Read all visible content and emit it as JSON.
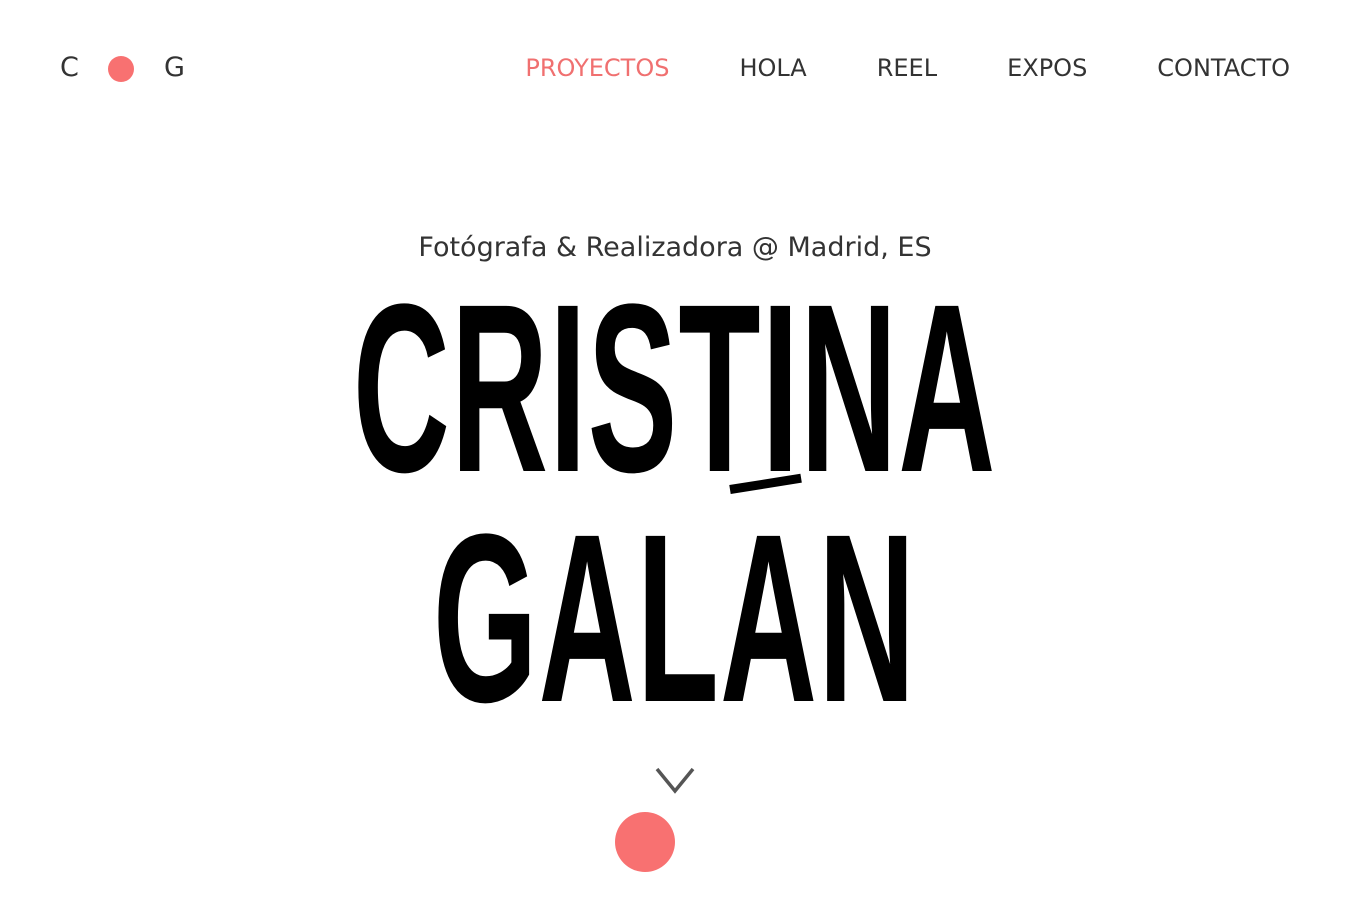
{
  "logo": {
    "left_letter": "C",
    "right_letter": "G",
    "dot_color": "#f87171"
  },
  "nav": {
    "active_color": "#f07070",
    "items": [
      {
        "label": "PROYECTOS",
        "active": true
      },
      {
        "label": "HOLA",
        "active": false
      },
      {
        "label": "REEL",
        "active": false
      },
      {
        "label": "EXPOS",
        "active": false
      },
      {
        "label": "CONTACTO",
        "active": false
      }
    ]
  },
  "hero": {
    "subtitle": "Fotógrafa & Realizadora @ Madrid, ES",
    "first_name": "CRISTINA",
    "last_name": "GALAN"
  },
  "scroll": {
    "icon": "chevron-down-icon",
    "dot_color": "#f87171"
  }
}
